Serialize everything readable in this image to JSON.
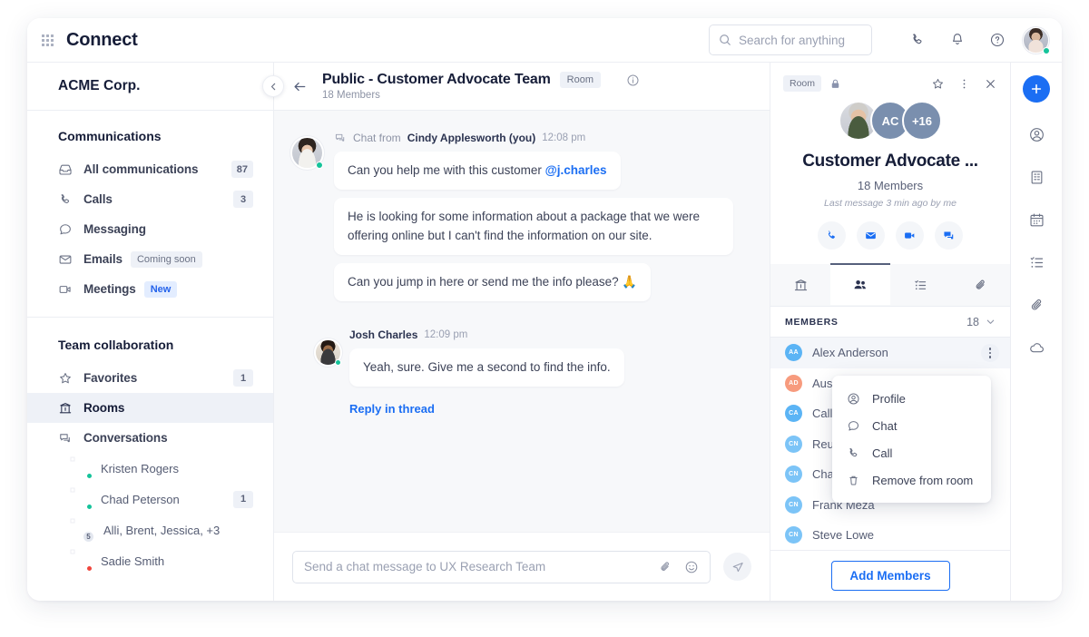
{
  "app": {
    "brand": "Connect",
    "grid_icon": "app-grid-icon"
  },
  "search": {
    "placeholder": "Search for anything",
    "icon": "search-icon"
  },
  "top_icons": [
    {
      "name": "phone-icon",
      "label": "Calls"
    },
    {
      "name": "bell-icon",
      "label": "Notifications"
    },
    {
      "name": "help-icon",
      "label": "Help"
    }
  ],
  "user_avatar": {
    "name": "current-user-avatar",
    "status": "online"
  },
  "sidebar": {
    "org_name": "ACME Corp.",
    "collapse_icon": "chevron-left-icon",
    "sections": [
      {
        "title": "Communications",
        "items": [
          {
            "label": "All communications",
            "icon": "inbox-icon",
            "badge": "87",
            "active": false
          },
          {
            "label": "Calls",
            "icon": "phone-icon",
            "badge": "3",
            "active": false
          },
          {
            "label": "Messaging",
            "icon": "chat-bubble-icon",
            "badge": "",
            "active": false
          },
          {
            "label": "Emails",
            "icon": "envelope-icon",
            "badge": "",
            "pill": "Coming soon",
            "pill_type": "soon",
            "active": false
          },
          {
            "label": "Meetings",
            "icon": "video-icon",
            "badge": "",
            "pill": "New",
            "pill_type": "new",
            "active": false
          }
        ]
      },
      {
        "title": "Team collaboration",
        "items": [
          {
            "label": "Favorites",
            "icon": "star-icon",
            "badge": "1",
            "active": false
          },
          {
            "label": "Rooms",
            "icon": "rooms-icon",
            "badge": "",
            "active": true
          },
          {
            "label": "Conversations",
            "icon": "conversations-icon",
            "badge": "",
            "active": false
          }
        ]
      }
    ],
    "conversations": [
      {
        "name": "Kristen Rogers",
        "status": "online",
        "badge": "",
        "group_count": ""
      },
      {
        "name": "Chad Peterson",
        "status": "online",
        "badge": "1",
        "group_count": ""
      },
      {
        "name": "Alli, Brent, Jessica, +3",
        "status": "",
        "badge": "",
        "group_count": "5"
      },
      {
        "name": "Sadie Smith",
        "status": "busy",
        "badge": "",
        "group_count": ""
      }
    ]
  },
  "chat": {
    "back_icon": "arrow-left-icon",
    "title": "Public - Customer Advocate Team",
    "tag": "Room",
    "subtitle": "18 Members",
    "info_icon": "info-circle-icon",
    "messages": [
      {
        "from_prefix": "Chat from",
        "author": "Cindy Applesworth (you)",
        "time": "12:08 pm",
        "meta_icon": "conversations-icon",
        "avatar_status": "online",
        "bubbles": [
          {
            "text": "Can you help me with this customer ",
            "mention": "@j.charles",
            "wide": false
          },
          {
            "text": "He is looking for some information about a package that we were offering online but I can't find the information on our site.",
            "mention": "",
            "wide": true
          },
          {
            "text": "Can you jump in here or send me the info please? 🙏",
            "mention": "",
            "wide": false
          }
        ],
        "reply_link": ""
      },
      {
        "from_prefix": "",
        "author": "Josh Charles",
        "time": "12:09 pm",
        "meta_icon": "",
        "avatar_status": "online",
        "bubbles": [
          {
            "text": "Yeah, sure. Give me a second to find the info.",
            "mention": "",
            "wide": false
          }
        ],
        "reply_link": "Reply in thread"
      }
    ],
    "composer": {
      "placeholder": "Send a chat message to UX Research Team",
      "attach_icon": "paperclip-icon",
      "emoji_icon": "smiley-icon",
      "send_icon": "send-icon"
    }
  },
  "right_panel": {
    "tag": "Room",
    "lock_icon": "lock-icon",
    "actions": [
      {
        "name": "star-icon"
      },
      {
        "name": "more-vertical-icon"
      },
      {
        "name": "close-icon"
      }
    ],
    "avatars": [
      {
        "type": "photo",
        "label": ""
      },
      {
        "type": "initials",
        "label": "AC"
      },
      {
        "type": "initials",
        "label": "+16"
      }
    ],
    "title": "Customer Advocate ...",
    "members_text": "18 Members",
    "last_message": "Last message 3 min ago by me",
    "quick_actions": [
      {
        "name": "phone-icon"
      },
      {
        "name": "envelope-icon"
      },
      {
        "name": "video-icon"
      },
      {
        "name": "chat-bubble-icon"
      }
    ],
    "tabs": [
      {
        "name": "tab-rooms",
        "icon": "rooms-icon",
        "active": false
      },
      {
        "name": "tab-members",
        "icon": "people-icon",
        "active": true
      },
      {
        "name": "tab-tasks",
        "icon": "list-icon",
        "active": false
      },
      {
        "name": "tab-files",
        "icon": "paperclip-icon",
        "active": false
      }
    ],
    "members_header": {
      "label": "MEMBERS",
      "count": "18",
      "chevron": "chevron-down-icon"
    },
    "members": [
      {
        "initials": "AA",
        "name": "Alex Anderson",
        "color": "#5bb4f5",
        "selected": true
      },
      {
        "initials": "AD",
        "name": "Austin Douglas",
        "color": "#f79b7e",
        "selected": false
      },
      {
        "initials": "CA",
        "name": "Callie Ashford",
        "color": "#5bb4f5",
        "selected": false
      },
      {
        "initials": "CN",
        "name": "Reuben Nelson",
        "color": "#7cc4f7",
        "selected": false
      },
      {
        "initials": "CN",
        "name": "Chad Nolan",
        "color": "#7cc4f7",
        "selected": false
      },
      {
        "initials": "CN",
        "name": "Frank Meza",
        "color": "#7cc4f7",
        "selected": false
      },
      {
        "initials": "CN",
        "name": "Steve Lowe",
        "color": "#7cc4f7",
        "selected": false
      }
    ],
    "context_menu": [
      {
        "label": "Profile",
        "icon": "user-circle-icon"
      },
      {
        "label": "Chat",
        "icon": "chat-bubble-icon"
      },
      {
        "label": "Call",
        "icon": "phone-icon"
      },
      {
        "label": "Remove from room",
        "icon": "trash-icon"
      }
    ],
    "add_members_label": "Add Members"
  },
  "rail": {
    "plus_icon": "plus-icon",
    "items": [
      {
        "name": "contacts-icon"
      },
      {
        "name": "building-icon"
      },
      {
        "name": "calendar-icon"
      },
      {
        "name": "tasks-icon"
      },
      {
        "name": "paperclip-icon"
      },
      {
        "name": "cloud-icon"
      }
    ]
  },
  "colors": {
    "accent": "#1b6ef3",
    "text_dark": "#161d38",
    "text_muted": "#8d93a5",
    "chat_bg": "#f7f8fa",
    "online": "#15c39a",
    "busy": "#f0453c"
  }
}
